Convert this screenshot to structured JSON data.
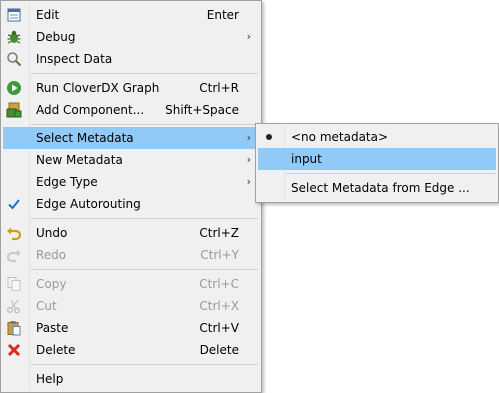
{
  "main_menu": {
    "items": [
      {
        "label": "Edit",
        "accel": "Enter",
        "icon": "edit-icon",
        "enabled": true
      },
      {
        "label": "Debug",
        "submenu": true,
        "icon": "debug-icon",
        "enabled": true
      },
      {
        "label": "Inspect Data",
        "icon": "inspect-icon",
        "enabled": true
      },
      {
        "label": "Run CloverDX Graph",
        "accel": "Ctrl+R",
        "icon": "run-icon",
        "enabled": true
      },
      {
        "label": "Add Component...",
        "accel": "Shift+Space",
        "icon": "add-component-icon",
        "enabled": true
      },
      {
        "label": "Select Metadata",
        "submenu": true,
        "enabled": true,
        "highlighted": true
      },
      {
        "label": "New Metadata",
        "submenu": true,
        "enabled": true
      },
      {
        "label": "Edge Type",
        "submenu": true,
        "enabled": true
      },
      {
        "label": "Edge Autorouting",
        "icon": "check-icon",
        "checked": true,
        "enabled": true
      },
      {
        "label": "Undo",
        "accel": "Ctrl+Z",
        "icon": "undo-icon",
        "enabled": true
      },
      {
        "label": "Redo",
        "accel": "Ctrl+Y",
        "icon": "redo-icon",
        "enabled": false
      },
      {
        "label": "Copy",
        "accel": "Ctrl+C",
        "icon": "copy-icon",
        "enabled": false
      },
      {
        "label": "Cut",
        "accel": "Ctrl+X",
        "icon": "cut-icon",
        "enabled": false
      },
      {
        "label": "Paste",
        "accel": "Ctrl+V",
        "icon": "paste-icon",
        "enabled": true
      },
      {
        "label": "Delete",
        "accel": "Delete",
        "icon": "delete-icon",
        "enabled": true
      },
      {
        "label": "Help",
        "enabled": true
      }
    ],
    "arrow_glyph": "›"
  },
  "sub_menu": {
    "items": [
      {
        "label": "<no metadata>",
        "selected": true
      },
      {
        "label": "input",
        "highlighted": true
      },
      {
        "label": "Select Metadata from Edge ..."
      }
    ]
  },
  "colors": {
    "menu_bg": "#f0f0f0",
    "highlight": "#91c9f7",
    "disabled_text": "#9a9a9a",
    "check": "#1e72c9"
  }
}
